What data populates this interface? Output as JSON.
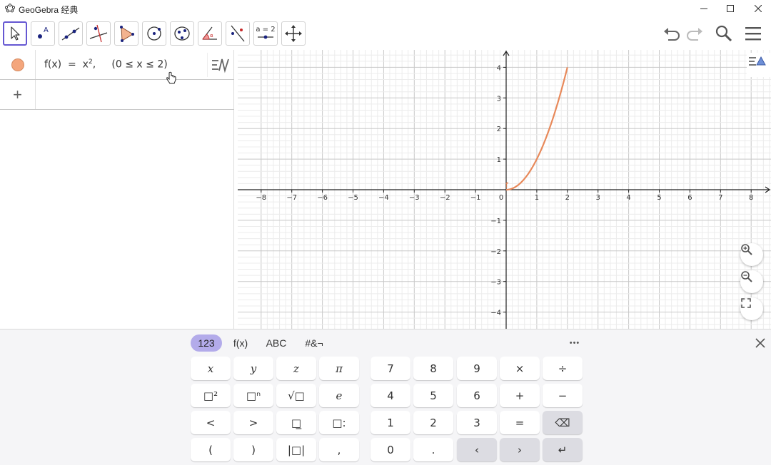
{
  "window": {
    "title": "GeoGebra 经典"
  },
  "algebra": {
    "entry": {
      "lhs": "f(x)  =  x",
      "exp": "2",
      "domain": ",     (0 ≤ x ≤ 2)"
    },
    "new_entry_symbol": "+"
  },
  "graphics": {
    "x_ticks": [
      "−8",
      "−7",
      "−6",
      "−5",
      "−4",
      "−3",
      "−2",
      "−1",
      "0",
      "1",
      "2",
      "3",
      "4",
      "5",
      "6",
      "7",
      "8"
    ],
    "y_ticks": [
      "4",
      "3",
      "2",
      "1",
      "−1",
      "−2",
      "−3",
      "−4"
    ],
    "function_label": "f",
    "function_color": "#e8895a"
  },
  "keyboard": {
    "tabs": [
      "123",
      "f(x)",
      "ABC",
      "#&¬"
    ],
    "more": "•••",
    "rows_left": [
      [
        "x",
        "y",
        "z",
        "π"
      ],
      [
        "□²",
        "□ⁿ",
        "√□",
        "e"
      ],
      [
        "<",
        ">",
        "□̲",
        "□:"
      ],
      [
        "(",
        ")",
        "|□|",
        ","
      ]
    ],
    "rows_right": [
      [
        "7",
        "8",
        "9",
        "×",
        "÷"
      ],
      [
        "4",
        "5",
        "6",
        "+",
        "−"
      ],
      [
        "1",
        "2",
        "3",
        "=",
        "⌫"
      ],
      [
        "0",
        ".",
        "‹",
        "›",
        "↵"
      ]
    ]
  }
}
